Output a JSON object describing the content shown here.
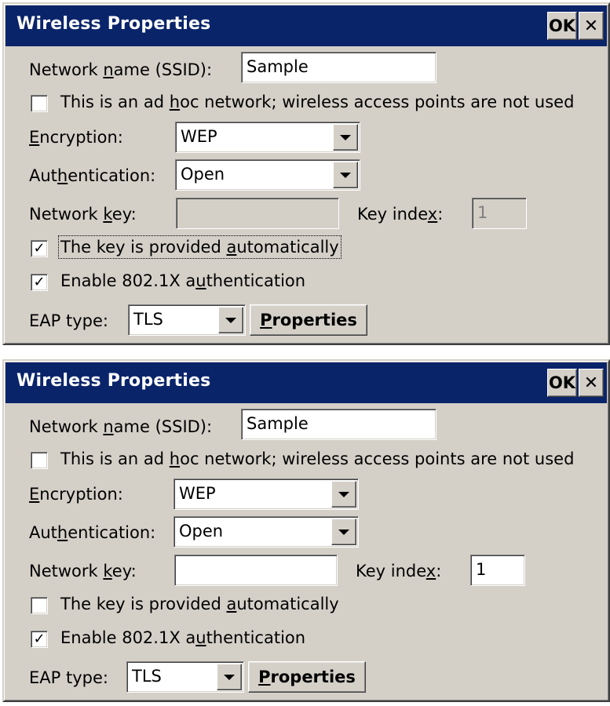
{
  "windows": [
    {
      "title": "Wireless Properties",
      "ok_label": "OK",
      "close_label": "✕",
      "ssid_label_pre": "Network ",
      "ssid_label_u": "n",
      "ssid_label_post": "ame (SSID):",
      "ssid_value": "Sample",
      "adhoc_label_pre": "This is an ad ",
      "adhoc_label_u": "h",
      "adhoc_label_post": "oc network; wireless access points are not used",
      "adhoc_checked": "",
      "encryption_label_u": "E",
      "encryption_label_post": "ncryption:",
      "encryption_value": "WEP",
      "auth_label_pre": "Aut",
      "auth_label_u": "h",
      "auth_label_post": "entication:",
      "auth_value": "Open",
      "netkey_label_pre": "Network ",
      "netkey_label_u": "k",
      "netkey_label_post": "ey:",
      "netkey_value": "",
      "keyindex_label_pre": "Key inde",
      "keyindex_label_u": "x",
      "keyindex_label_post": ":",
      "keyindex_value": "1",
      "auto_label_pre": "The key is provided ",
      "auto_label_u": "a",
      "auto_label_post": "utomatically",
      "auto_checked": "✓",
      "dot1x_label_pre": "Enable 802.1X a",
      "dot1x_label_u": "u",
      "dot1x_label_post": "thentication",
      "dot1x_checked": "✓",
      "eap_label": "EAP type:",
      "eap_value": "TLS",
      "properties_u": "P",
      "properties_post": "roperties"
    },
    {
      "title": "Wireless Properties",
      "ok_label": "OK",
      "close_label": "✕",
      "ssid_label_pre": "Network ",
      "ssid_label_u": "n",
      "ssid_label_post": "ame (SSID):",
      "ssid_value": "Sample",
      "adhoc_label_pre": "This is an ad ",
      "adhoc_label_u": "h",
      "adhoc_label_post": "oc network; wireless access points are not used",
      "adhoc_checked": "",
      "encryption_label_u": "E",
      "encryption_label_post": "ncryption:",
      "encryption_value": "WEP",
      "auth_label_pre": "Aut",
      "auth_label_u": "h",
      "auth_label_post": "entication:",
      "auth_value": "Open",
      "netkey_label_pre": "Network ",
      "netkey_label_u": "k",
      "netkey_label_post": "ey:",
      "netkey_value": "",
      "keyindex_label_pre": "Key inde",
      "keyindex_label_u": "x",
      "keyindex_label_post": ":",
      "keyindex_value": "1",
      "auto_label_pre": "The key is provided ",
      "auto_label_u": "a",
      "auto_label_post": "utomatically",
      "auto_checked": "",
      "dot1x_label_pre": "Enable 802.1X a",
      "dot1x_label_u": "u",
      "dot1x_label_post": "thentication",
      "dot1x_checked": "✓",
      "eap_label": "EAP type:",
      "eap_value": "TLS",
      "properties_u": "P",
      "properties_post": "roperties"
    }
  ]
}
